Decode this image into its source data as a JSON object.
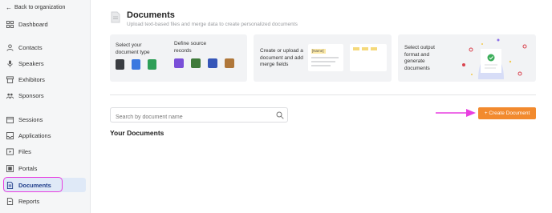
{
  "sidebar": {
    "back_label": "Back to organization",
    "items": [
      {
        "label": "Dashboard",
        "icon": "grid-icon"
      },
      {
        "label": "Contacts",
        "icon": "person-icon"
      },
      {
        "label": "Speakers",
        "icon": "microphone-icon"
      },
      {
        "label": "Exhibitors",
        "icon": "storefront-icon"
      },
      {
        "label": "Sponsors",
        "icon": "people-icon"
      },
      {
        "label": "Sessions",
        "icon": "calendar-icon"
      },
      {
        "label": "Applications",
        "icon": "inbox-icon"
      },
      {
        "label": "Files",
        "icon": "folder-icon"
      },
      {
        "label": "Portals",
        "icon": "portal-icon"
      },
      {
        "label": "Documents",
        "icon": "document-icon",
        "active": true
      },
      {
        "label": "Reports",
        "icon": "report-icon"
      }
    ]
  },
  "header": {
    "title": "Documents",
    "subtitle": "Upload text-based files and merge data to create personalized documents"
  },
  "steps": {
    "doc_type": "Select your document type",
    "source": "Define source records",
    "merge": "Create or upload a document and add merge fields",
    "merge_tag": "[Name]",
    "output": "Select output format and generate documents"
  },
  "search": {
    "placeholder": "Search by document name",
    "value": ""
  },
  "create_button": "+ Create Document",
  "section_title": "Your Documents",
  "colors": {
    "accent_orange": "#f28a2e",
    "highlight_pink": "#e83ee0",
    "active_nav_bg": "#dfe9f7"
  }
}
